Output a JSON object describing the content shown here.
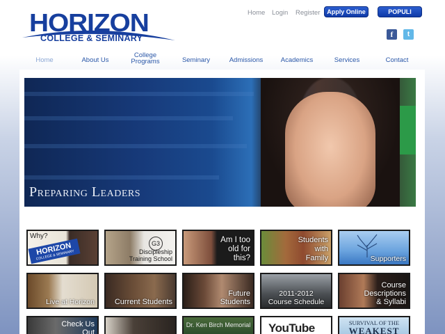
{
  "logo": {
    "word": "HORIZON",
    "sub": "COLLEGE & SEMINARY"
  },
  "toplinks": {
    "home": "Home",
    "login": "Login",
    "register": "Register"
  },
  "buttons": {
    "apply": "Apply Online",
    "populi": "POPULI"
  },
  "social": {
    "facebook": "f",
    "twitter": "t"
  },
  "nav": {
    "home": "Home",
    "about": "About Us",
    "college_line1": "College",
    "college_line2": "Programs",
    "seminary": "Seminary",
    "admissions": "Admissions",
    "academics": "Academics",
    "services": "Services",
    "contact": "Contact"
  },
  "hero": {
    "title": "Preparing Leaders"
  },
  "tiles": {
    "why_line1": "Why?",
    "why_logo": "HORIZON",
    "why_sub": "COLLEGE & SEMINARY",
    "g3_badge": "G3",
    "g3_line1": "Discipleship",
    "g3_line2": "Training School",
    "old_line1": "Am I too",
    "old_line2": "old for",
    "old_line3": "this?",
    "family_line1": "Students",
    "family_line2": "with",
    "family_line3": "Family",
    "supporters": "Supporters",
    "live": "Live at Horizon",
    "current": "Current Students",
    "future_line1": "Future",
    "future_line2": "Students",
    "schedule_line1": "2011-2012",
    "schedule_line2": "Course Schedule",
    "course_line1": "Course",
    "course_line2": "Descriptions",
    "course_line3": "& Syllabi",
    "check_line1": "Check Us",
    "check_line2": "Out",
    "memorial": "Dr. Ken Birch Memorial",
    "youtube": "YouTube",
    "weakest_line1": "SURVIVAL OF THE",
    "weakest_line2": "WEAKEST"
  },
  "colors": {
    "brand": "#173f9e",
    "nav": "#2a57a8",
    "button": "#1a47b8"
  }
}
